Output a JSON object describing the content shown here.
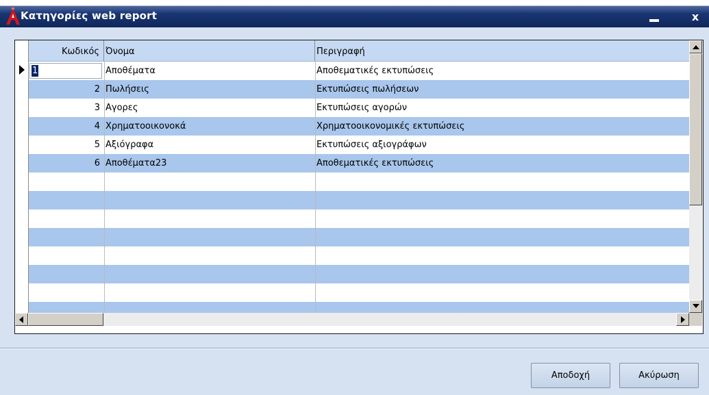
{
  "window": {
    "title": "Κατηγορίες web report",
    "close_label": "x"
  },
  "grid": {
    "columns": [
      "Κωδικός",
      "Όνομα",
      "Περιγραφή"
    ],
    "rows": [
      {
        "code": "1",
        "name": "Αποθέματα",
        "description": "Αποθεματικές εκτυπώσεις"
      },
      {
        "code": "2",
        "name": "Πωλήσεις",
        "description": "Εκτυπώσεις πωλήσεων"
      },
      {
        "code": "3",
        "name": "Αγορες",
        "description": "Εκτυπώσεις  αγορών"
      },
      {
        "code": "4",
        "name": "Χρηματοοικονοκά",
        "description": "Χρηματοοικονομικές εκτυπώσεις"
      },
      {
        "code": "5",
        "name": "Αξιόγραφα",
        "description": "Εκτυπώσεις αξιογράφων"
      },
      {
        "code": "6",
        "name": "Αποθέματα23",
        "description": "Αποθεματικές εκτυπώσεις"
      }
    ],
    "row_colors": [
      "#ffffff",
      "#a9c6ec"
    ],
    "header_color": "#c5d9f2",
    "selection_color": "#0a246a"
  },
  "buttons": {
    "accept": "Αποδοχή",
    "cancel": "Ακύρωση"
  },
  "icons": {
    "app": "red-a-logo-icon",
    "minimize": "minimize-icon",
    "close": "close-icon"
  }
}
